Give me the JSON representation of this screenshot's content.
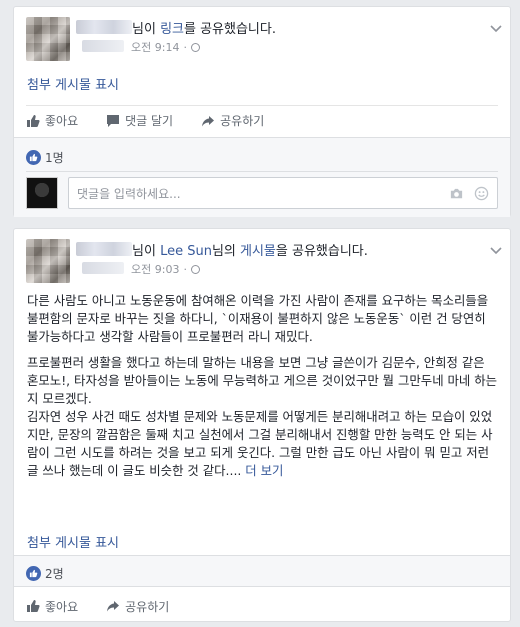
{
  "post1": {
    "header_suffix_pre": "님이 ",
    "header_link": "링크",
    "header_suffix_post": "를 공유했습니다.",
    "time": "오전 9:14",
    "attachment_label": "첨부 게시물 표시",
    "actions": {
      "like": "좋아요",
      "comment": "댓글 달기",
      "share": "공유하기"
    },
    "like_count": "1명",
    "comment_placeholder": "댓글을 입력하세요..."
  },
  "post2": {
    "header_suffix_pre": "님이 ",
    "header_name": "Lee Sun",
    "header_mid": "님의 ",
    "header_link": "게시물",
    "header_suffix_post": "을 공유했습니다.",
    "time": "오전 9:03",
    "paragraphs": [
      "다른 사람도 아니고 노동운동에 참여해온 이력을 가진 사람이 존재를 요구하는 목소리들을 불편함의 문자로 바꾸는 짓을 하다니, `이재용이 불편하지 않은 노동운동` 이런 건 당연히 불가능하다고 생각할 사람들이 프로불편러 라니 재밌다.",
      "프로불편러 생활을 했다고 하는데 말하는 내용을 보면 그냥 글쓴이가 김문수, 안희정 같은 혼모노!, 타자성을 받아들이는 노동에 무능력하고 게으른 것이었구만 뭘 그만두네 마네 하는지 모르겠다."
    ],
    "paragraph3": "김자연 성우 사건 때도 성차별 문제와 노동문제를 어떻게든 분리해내려고 하는 모습이 있었지만, 문장의 깔끔함은 둘째 치고 실천에서 그걸 분리해내서 진행할 만한 능력도 안 되는 사람이 그런 시도를 하려는 것을 보고 되게 웃긴다. 그럴 만한 급도 아닌 사람이 뭐 믿고 저런 글 쓰나 했는데 이 글도 비슷한 것 같다....",
    "see_more": "더 보기",
    "attachment_label": "첨부 게시물 표시",
    "like_count": "2명",
    "actions": {
      "like": "좋아요",
      "share": "공유하기"
    }
  },
  "colors": {
    "link": "#365899",
    "like": "#4267b2",
    "background": "#e9ebee"
  }
}
